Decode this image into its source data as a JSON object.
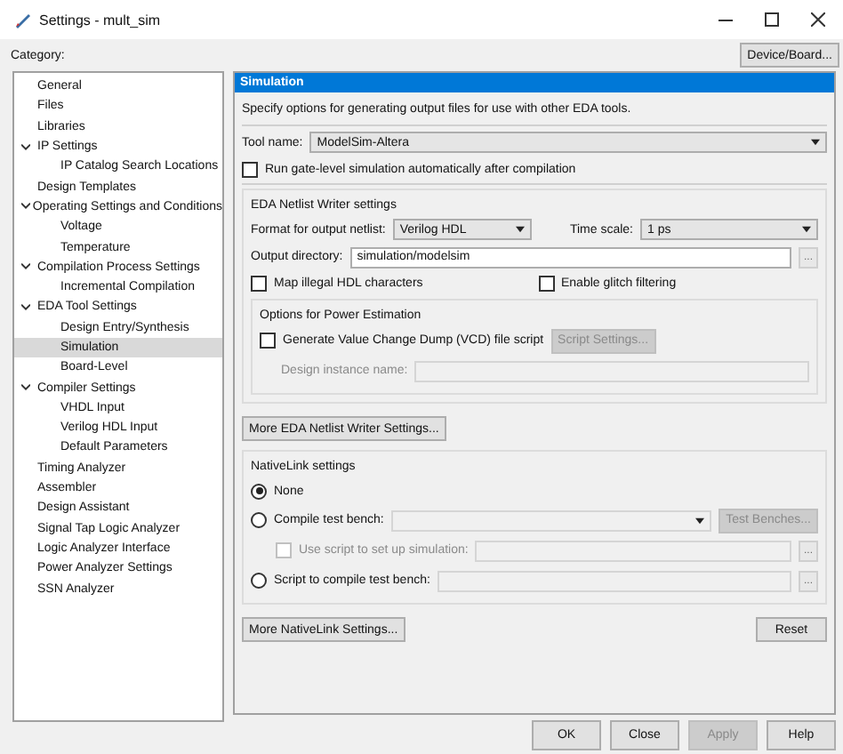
{
  "window": {
    "title": "Settings - mult_sim"
  },
  "category_label": "Category:",
  "device_button": {
    "label": "Device/Board..."
  },
  "tree": [
    {
      "label": "General",
      "selected": false
    },
    {
      "label": "Files",
      "selected": false
    },
    {
      "label": "Libraries",
      "selected": false
    },
    {
      "label": "IP Settings",
      "selected": false,
      "expanded": true,
      "children": [
        {
          "label": "IP Catalog Search Locations",
          "selected": false
        }
      ]
    },
    {
      "label": "Design Templates",
      "selected": false
    },
    {
      "label": "Operating Settings and Conditions",
      "selected": false,
      "expanded": true,
      "children": [
        {
          "label": "Voltage",
          "selected": false
        },
        {
          "label": "Temperature",
          "selected": false
        }
      ]
    },
    {
      "label": "Compilation Process Settings",
      "selected": false,
      "expanded": true,
      "children": [
        {
          "label": "Incremental Compilation",
          "selected": false
        }
      ]
    },
    {
      "label": "EDA Tool Settings",
      "selected": false,
      "expanded": true,
      "children": [
        {
          "label": "Design Entry/Synthesis",
          "selected": false
        },
        {
          "label": "Simulation",
          "selected": true
        },
        {
          "label": "Board-Level",
          "selected": false
        }
      ]
    },
    {
      "label": "Compiler Settings",
      "selected": false,
      "expanded": true,
      "children": [
        {
          "label": "VHDL Input",
          "selected": false
        },
        {
          "label": "Verilog HDL Input",
          "selected": false
        },
        {
          "label": "Default Parameters",
          "selected": false
        }
      ]
    },
    {
      "label": "Timing Analyzer",
      "selected": false
    },
    {
      "label": "Assembler",
      "selected": false
    },
    {
      "label": "Design Assistant",
      "selected": false
    },
    {
      "label": "Signal Tap Logic Analyzer",
      "selected": false
    },
    {
      "label": "Logic Analyzer Interface",
      "selected": false
    },
    {
      "label": "Power Analyzer Settings",
      "selected": false
    },
    {
      "label": "SSN Analyzer",
      "selected": false
    }
  ],
  "panel": {
    "title": "Simulation",
    "description": "Specify options for generating output files for use with other EDA tools.",
    "tool_name": {
      "label": "Tool name:",
      "value": "ModelSim-Altera"
    },
    "run_gate": {
      "label": "Run gate-level simulation automatically after compilation",
      "checked": false
    },
    "netlist": {
      "title": "EDA Netlist Writer settings",
      "format": {
        "label": "Format for output netlist:",
        "value": "Verilog HDL"
      },
      "time_scale": {
        "label": "Time scale:",
        "value": "1 ps"
      },
      "output_dir": {
        "label": "Output directory:",
        "value": "simulation/modelsim",
        "browse": "..."
      },
      "map_illegal": {
        "label": "Map illegal HDL characters",
        "checked": false
      },
      "glitch": {
        "label": "Enable glitch filtering",
        "checked": false
      },
      "power": {
        "title": "Options for Power Estimation",
        "vcd": {
          "label": "Generate Value Change Dump (VCD) file script",
          "checked": false
        },
        "script_settings": {
          "label": "Script Settings...",
          "disabled": true
        },
        "instance": {
          "label": "Design instance name:",
          "disabled": true
        }
      }
    },
    "more_netlist": {
      "label": "More EDA Netlist Writer Settings..."
    },
    "nativelink": {
      "title": "NativeLink settings",
      "none": {
        "label": "None",
        "selected": true
      },
      "compile": {
        "label": "Compile test bench:",
        "selected": false,
        "button": "Test Benches...",
        "disabled": true
      },
      "use_script": {
        "label": "Use script to set up simulation:",
        "checked": false,
        "disabled": true,
        "browse": "..."
      },
      "script": {
        "label": "Script to compile test bench:",
        "selected": false,
        "browse": "..."
      }
    },
    "more_nativelink": {
      "label": "More NativeLink Settings..."
    },
    "reset": {
      "label": "Reset"
    }
  },
  "buttons": [
    {
      "label": "OK",
      "disabled": false
    },
    {
      "label": "Close",
      "disabled": false
    },
    {
      "label": "Apply",
      "disabled": true
    },
    {
      "label": "Help",
      "disabled": false
    }
  ]
}
